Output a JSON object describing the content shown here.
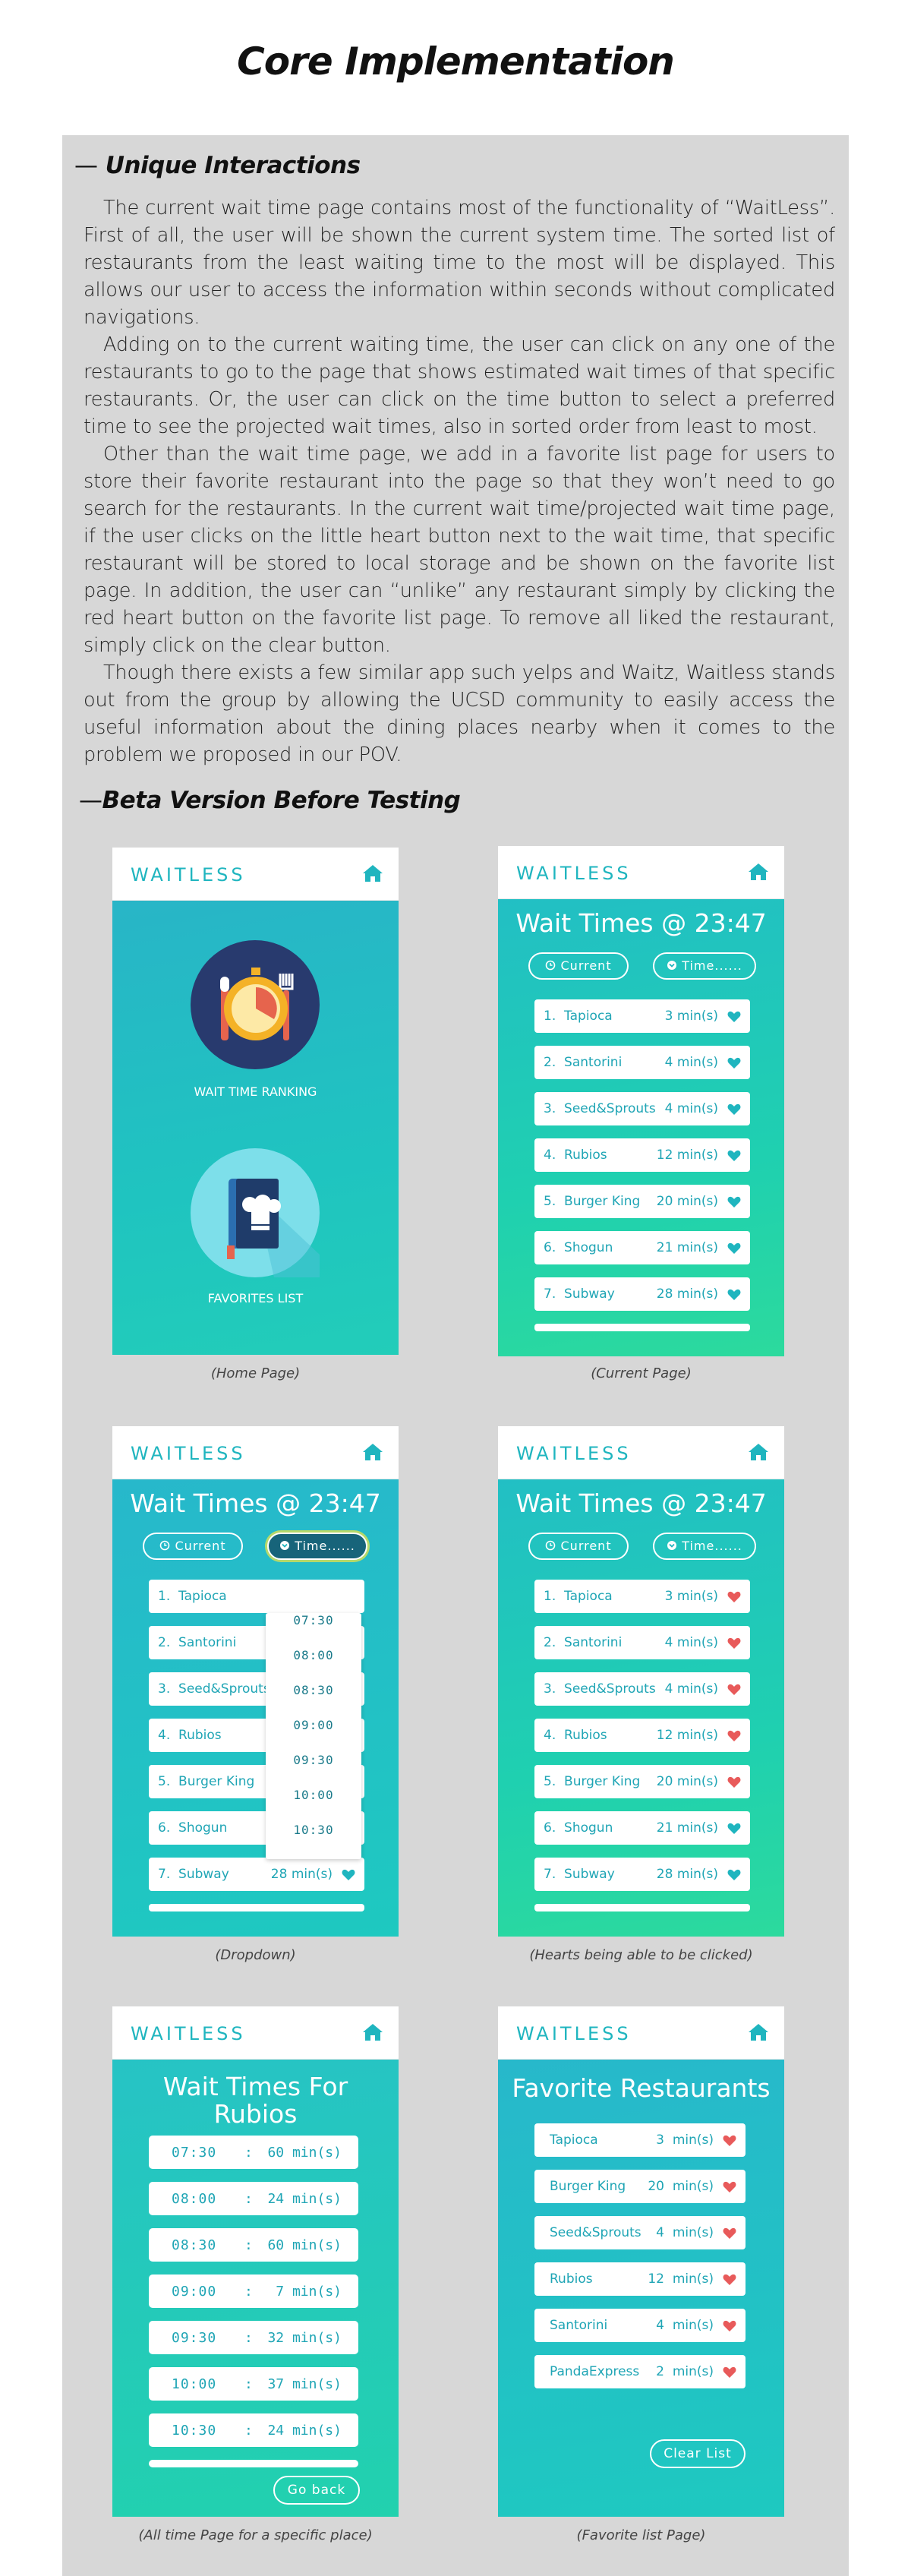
{
  "title": "Core Implementation",
  "section1": {
    "dash": "—",
    "heading": "Unique Interactions",
    "paragraphs": [
      "The current wait time page contains most of the functionality of “WaitLess”. First of all, the user will be shown the current system time. The sorted list of restaurants from the least waiting time to the most will be displayed. This allows our user to access the information within seconds without complicated navigations.",
      "Adding on to the current waiting time, the user can click on any one of the restaurants to go to the page that shows estimated wait times of that specific restaurants. Or, the user can click on the time button to select a preferred time to see the projected wait times, also in sorted order from least to most.",
      "Other than the wait time page, we add in a favorite list page for users to store their favorite restaurant into the page so that they won’t need to go search for the restaurants. In the current wait time/projected wait time page, if the user clicks on the little heart button next to the wait time, that specific restaurant will be stored to local storage and be shown on the favorite list page. In addition, the user can “unlike” any restaurant simply by clicking the red heart button on the favorite list page. To remove all liked the restaurant, simply click on the clear button.",
      "Though there exists a few similar app such yelps and Waitz, Waitless stands out from the group by allowing the UCSD community to easily access the useful information about the dining places nearby when it comes to the problem we proposed in our POV."
    ]
  },
  "section2": {
    "dash": "—",
    "heading": "Beta Version Before Testing"
  },
  "app": {
    "brand": "WAITLESS",
    "wait_title": "Wait Times @ 23:47",
    "current_btn": "Current",
    "time_btn": "Time......",
    "home_labels": [
      "WAIT TIME RANKING",
      "FAVORITES LIST"
    ],
    "rows": [
      {
        "n": "1.",
        "name": "Tapioca",
        "t": "3 min(s)"
      },
      {
        "n": "2.",
        "name": "Santorini",
        "t": "4 min(s)"
      },
      {
        "n": "3.",
        "name": "Seed&Sprouts",
        "t": "4 min(s)"
      },
      {
        "n": "4.",
        "name": "Rubios",
        "t": "12 min(s)"
      },
      {
        "n": "5.",
        "name": "Burger King",
        "t": "20 min(s)"
      },
      {
        "n": "6.",
        "name": "Shogun",
        "t": "21 min(s)"
      },
      {
        "n": "7.",
        "name": "Subway",
        "t": "28 min(s)"
      }
    ],
    "dropdown": [
      "07:30",
      "08:00",
      "08:30",
      "09:00",
      "09:30",
      "10:00",
      "10:30"
    ],
    "time_page_title": [
      "Wait Times For",
      "Rubios"
    ],
    "time_rows": [
      {
        "time": "07:30",
        "sep": ":",
        "val": "60 min(s)"
      },
      {
        "time": "08:00",
        "sep": ":",
        "val": "24 min(s)"
      },
      {
        "time": "08:30",
        "sep": ":",
        "val": "60 min(s)"
      },
      {
        "time": "09:00",
        "sep": ":",
        "val": "7 min(s)"
      },
      {
        "time": "09:30",
        "sep": ":",
        "val": "32 min(s)"
      },
      {
        "time": "10:00",
        "sep": ":",
        "val": "37 min(s)"
      },
      {
        "time": "10:30",
        "sep": ":",
        "val": "24 min(s)"
      }
    ],
    "go_back": "Go back",
    "fav_title": "Favorite Restaurants",
    "fav_rows": [
      {
        "name": "Tapioca",
        "val": "3",
        "unit": "min(s)"
      },
      {
        "name": "Burger King",
        "val": "20",
        "unit": "min(s)"
      },
      {
        "name": "Seed&Sprouts",
        "val": "4",
        "unit": "min(s)"
      },
      {
        "name": "Rubios",
        "val": "12",
        "unit": "min(s)"
      },
      {
        "name": "Santorini",
        "val": "4",
        "unit": "min(s)"
      },
      {
        "name": "PandaExpress",
        "val": "2",
        "unit": "min(s)"
      }
    ],
    "clear_list": "Clear List",
    "colors": {
      "teal": "#1fb5bf",
      "heart_teal": "#1fb5bf",
      "heart_red": "#e85a5a"
    }
  },
  "captions": [
    "(Home Page)",
    "(Current Page)",
    "(Dropdown)",
    "(Hearts being able to be clicked)",
    "(All time Page for a specific place)",
    "(Favorite list Page)"
  ]
}
